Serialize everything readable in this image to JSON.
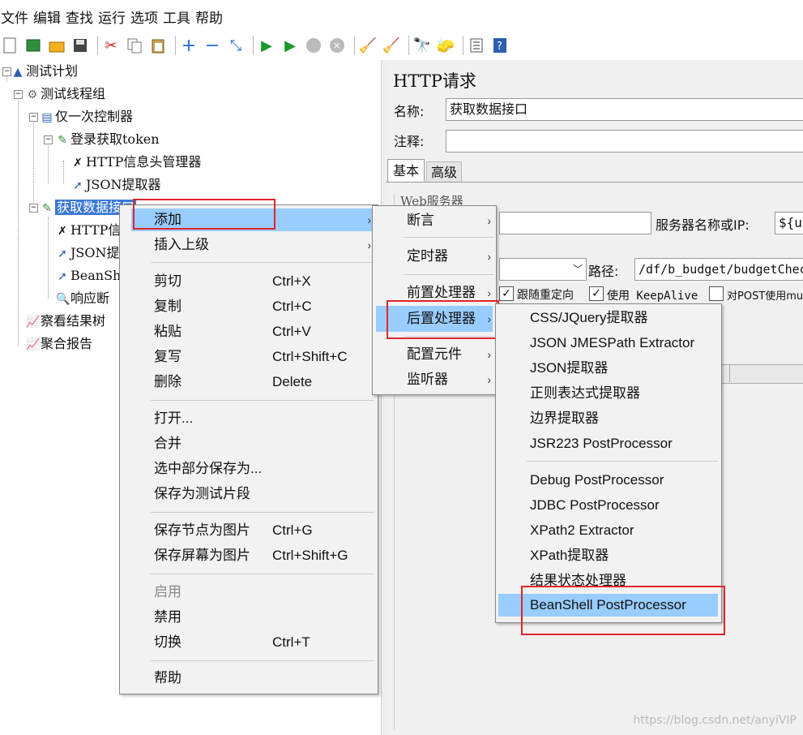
{
  "menubar": [
    "文件",
    "编辑",
    "查找",
    "运行",
    "选项",
    "工具",
    "帮助"
  ],
  "toolbar_icons": [
    "new-icon",
    "templates-icon",
    "open-icon",
    "save-icon",
    "cut-icon",
    "copy-icon",
    "paste-icon",
    "expand-icon",
    "collapse-icon",
    "toggle-icon",
    "start-icon",
    "start-no-pause-icon",
    "stop-icon",
    "shutdown-icon",
    "clear-icon",
    "clear-all-icon",
    "search-icon",
    "reset-search-icon",
    "function-helper-icon",
    "help-icon"
  ],
  "tree": {
    "plan": "测试计划",
    "thread_group": "测试线程组",
    "once_controller": "仅一次控制器",
    "login": "登录获取token",
    "http_header_mgr": "HTTP信息头管理器",
    "json_extractor": "JSON提取器",
    "get_data": "获取数据接口",
    "http_header_mgr2": "HTTP信",
    "json_extractor2": "JSON提",
    "beanshell": "BeanSh",
    "assertion": "响应断",
    "result_tree": "察看结果树",
    "aggregate": "聚合报告"
  },
  "panel": {
    "title": "HTTP请求",
    "name_label": "名称:",
    "name_value": "获取数据接口",
    "comment_label": "注释:",
    "tab_basic": "基本",
    "tab_advanced": "高级",
    "web_server": "Web服务器",
    "server_label": "服务器名称或IP:",
    "server_value": "${ur",
    "path_label": "路径:",
    "path_value": "/df/b_budget/budgetChec",
    "follow_redirect": "跟随重定向",
    "keepalive": "使用 KeepAlive",
    "post_multipart": "对POST使用mu"
  },
  "context_menu": {
    "add": "添加",
    "insert_parent": "插入上级",
    "cut": "剪切",
    "cut_key": "Ctrl+X",
    "copy": "复制",
    "copy_key": "Ctrl+C",
    "paste": "粘贴",
    "paste_key": "Ctrl+V",
    "duplicate": "复写",
    "duplicate_key": "Ctrl+Shift+C",
    "delete": "删除",
    "delete_key": "Delete",
    "open": "打开...",
    "merge": "合并",
    "save_selection": "选中部分保存为...",
    "save_fragment": "保存为测试片段",
    "save_node_image": "保存节点为图片",
    "save_node_image_key": "Ctrl+G",
    "save_screen_image": "保存屏幕为图片",
    "save_screen_image_key": "Ctrl+Shift+G",
    "enable": "启用",
    "disable": "禁用",
    "toggle": "切换",
    "toggle_key": "Ctrl+T",
    "help": "帮助"
  },
  "add_menu": {
    "assertion": "断言",
    "timer": "定时器",
    "pre_processor": "前置处理器",
    "post_processor": "后置处理器",
    "config_element": "配置元件",
    "listener": "监听器"
  },
  "post_menu": {
    "css_jquery": "CSS/JQuery提取器",
    "json_jmespath": "JSON JMESPath Extractor",
    "json_extractor": "JSON提取器",
    "regex": "正则表达式提取器",
    "boundary": "边界提取器",
    "jsr223": "JSR223 PostProcessor",
    "debug": "Debug PostProcessor",
    "jdbc": "JDBC PostProcessor",
    "xpath2": "XPath2 Extractor",
    "xpath": "XPath提取器",
    "result_status": "结果状态处理器",
    "beanshell": "BeanShell PostProcessor"
  },
  "watermark": "https://blog.csdn.net/anyiVIP",
  "colors": {
    "highlight": "#99ccff",
    "selected": "#3a78d6",
    "redbox": "#e0262b"
  }
}
